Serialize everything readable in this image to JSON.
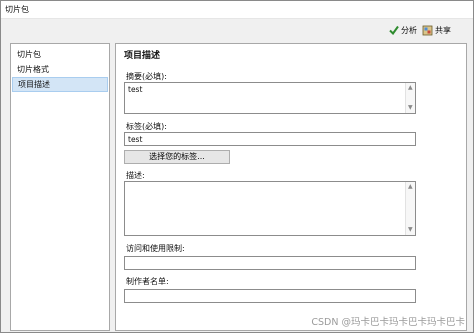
{
  "window": {
    "title": "切片包"
  },
  "toolbar": {
    "analyze_label": "分析",
    "share_label": "共享",
    "analyze_icon": "checkmark-icon",
    "share_icon": "share-package-icon",
    "accent": "#2e8b2e"
  },
  "sidebar": {
    "items": [
      {
        "label": "切片包"
      },
      {
        "label": "切片格式"
      },
      {
        "label": "项目描述"
      }
    ],
    "selected_index": 2
  },
  "panel": {
    "title": "项目描述",
    "summary": {
      "label": "摘要(必填):",
      "value": "test"
    },
    "tags": {
      "label": "标签(必填):",
      "value": "test",
      "button": "选择您的标签..."
    },
    "description": {
      "label": "描述:",
      "value": ""
    },
    "access": {
      "label": "访问和使用限制:",
      "value": ""
    },
    "author": {
      "label": "制作者名单:",
      "value": ""
    }
  },
  "watermark": "CSDN @玛卡巴卡玛卡巴卡玛卡巴卡"
}
